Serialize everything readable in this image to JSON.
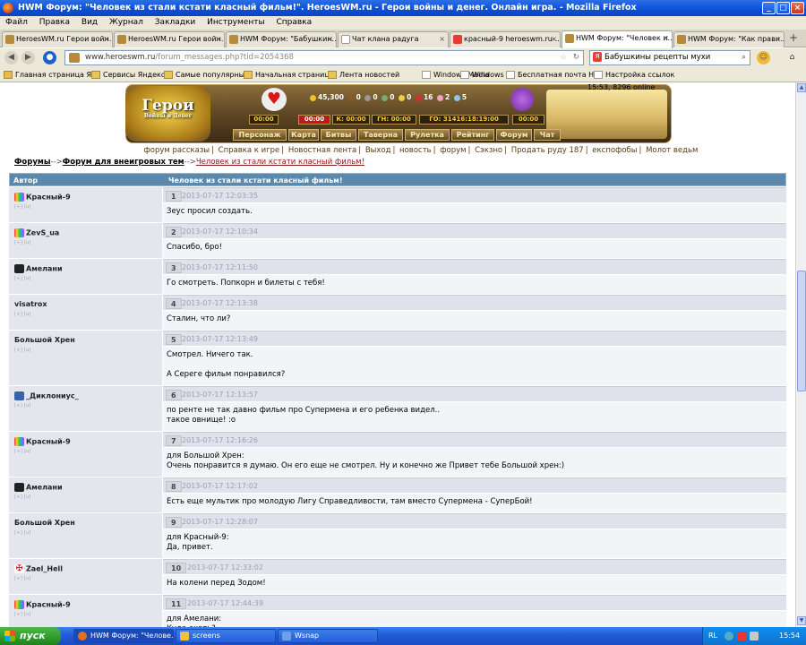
{
  "window": {
    "title": "HWM Форум: \"Человек из стали кстати класный фильм!\". HeroesWM.ru - Герои войны и денег. Онлайн игра. - Mozilla Firefox"
  },
  "menu": [
    "Файл",
    "Правка",
    "Вид",
    "Журнал",
    "Закладки",
    "Инструменты",
    "Справка"
  ],
  "tabs": [
    "HeroesWM.ru Герои войн...",
    "HeroesWM.ru Герои войн...",
    "HWM Форум: \"Бабушкин...",
    "Чат клана радуга",
    "красный-9 heroeswm.ru-...",
    "HWM Форум: \"Человек и...",
    "HWM Форум: \"Как прави..."
  ],
  "url": {
    "host": "www.heroeswm.ru",
    "path": "/forum_messages.php?tid=2054368"
  },
  "search": {
    "value": "Бабушкины рецепты мухи"
  },
  "bookmarks": [
    "Главная страница Я...",
    "Сервисы Яндекса",
    "Самые популярные",
    "Начальная страница",
    "Лента новостей",
    "Windows Media",
    "Windows",
    "Бесплатная почта H...",
    "Настройка ссылок"
  ],
  "game": {
    "logo": "Герои",
    "logo_sub": "Войны и Денег",
    "time_online": "15:53, 8296 online",
    "stats": [
      "45,300",
      "0",
      "0",
      "0",
      "0",
      "16",
      "2",
      "5"
    ],
    "timers": [
      "00:00",
      "00:00",
      "К: 00:00",
      "ГН: 00:00",
      "ГО: 31416:18:19:00",
      "00:00"
    ],
    "menu": [
      "Персонаж",
      "Карта",
      "Битвы",
      "Таверна",
      "Рулетка",
      "Рейтинг",
      "Форум",
      "Чат"
    ],
    "links": [
      "форум рассказы",
      "Справка к игре",
      "Новостная лента",
      "Выход",
      "новость",
      "форум",
      "Сэкзно",
      "Продать руду 187",
      "експофобы",
      "Молот ведьм"
    ]
  },
  "breadcrumb": {
    "forums": "Форумы",
    "sep1": "-->",
    "section": "Форум для внеигровых тем",
    "sep2": "-->",
    "topic": "Человек из стали кстати класный фильм!"
  },
  "table": {
    "col_author": "Автор",
    "col_topic": "Человек из стали кстати класный фильм!"
  },
  "posts": [
    {
      "n": "1",
      "date": "2013-07-17 12:03:35",
      "author": "Красный-9",
      "body": "Зеус просил создать."
    },
    {
      "n": "2",
      "date": "2013-07-17 12:10:34",
      "author": "ZevS_ua",
      "body": "Спасибо, бро!"
    },
    {
      "n": "3",
      "date": "2013-07-17 12:11:50",
      "author": "Амелани",
      "body": "Го смотреть. Попкорн и билеты с тебя!"
    },
    {
      "n": "4",
      "date": "2013-07-17 12:13:38",
      "author": "visatrox",
      "body": "Сталин, что ли?"
    },
    {
      "n": "5",
      "date": "2013-07-17 12:13:49",
      "author": "Большой Хрен",
      "body": "Смотрел. Ничего так.\n\nА Сереге фильм понравился?"
    },
    {
      "n": "6",
      "date": "2013-07-17 12:13:57",
      "author": "_Диклониус_",
      "body": "по ренте не так давно фильм про Супермена и его ребенка видел..\nтакое овнище! :о"
    },
    {
      "n": "7",
      "date": "2013-07-17 12:16:26",
      "author": "Красный-9",
      "body": "для Большой Хрен:\nОчень понравится я думаю. Он его еще не смотрел. Ну и конечно же Привет тебе Большой хрен:)"
    },
    {
      "n": "8",
      "date": "2013-07-17 12:17:02",
      "author": "Амелани",
      "body": "Есть еще мультик про молодую Лигу Справедливости, там вместо Супермена - СуперБой!"
    },
    {
      "n": "9",
      "date": "2013-07-17 12:28:07",
      "author": "Большой Хрен",
      "body": "для Красный-9:\nДа, привет."
    },
    {
      "n": "10",
      "date": "2013-07-17 12:33:02",
      "author": "Zael_Hell",
      "body": "На колени перед Зодом!"
    },
    {
      "n": "11",
      "date": "2013-07-17 12:44:39",
      "author": "Красный-9",
      "body": "для Амелани:\nКуда ехать?"
    }
  ],
  "taskbar": {
    "start": "пуск",
    "tasks": [
      "HWM Форум: \"Челове...",
      "screens",
      "Wsnap"
    ],
    "lang": "RL",
    "clock": "15:54"
  }
}
